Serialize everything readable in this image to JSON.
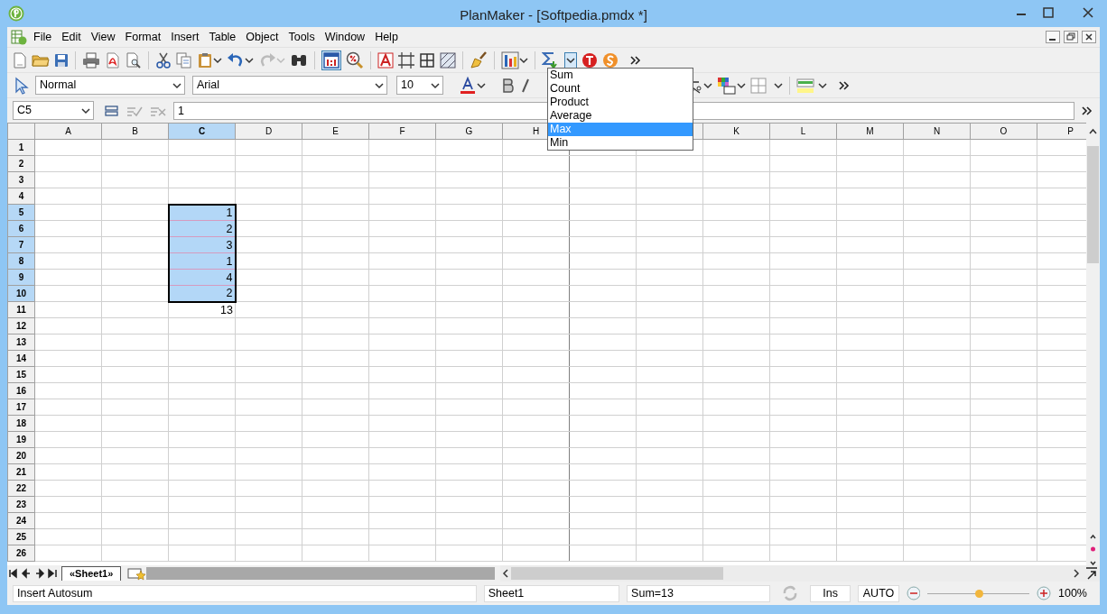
{
  "window": {
    "title": "PlanMaker - [Softpedia.pmdx *]"
  },
  "menu": [
    "File",
    "Edit",
    "View",
    "Format",
    "Insert",
    "Table",
    "Object",
    "Tools",
    "Window",
    "Help"
  ],
  "toolbar": {
    "actual_size_pressed": true,
    "redo_disabled": true,
    "autosum_expanded": true
  },
  "autosum_menu": [
    {
      "label": "Sum",
      "selected": false
    },
    {
      "label": "Count",
      "selected": false
    },
    {
      "label": "Product",
      "selected": false
    },
    {
      "label": "Average",
      "selected": false
    },
    {
      "label": "Max",
      "selected": true
    },
    {
      "label": "Min",
      "selected": false
    }
  ],
  "format_bar": {
    "style": "Normal",
    "font": "Arial",
    "size": "10"
  },
  "formula_bar": {
    "cell_reference": "C5",
    "content": "1"
  },
  "grid": {
    "columns": [
      {
        "header": "A",
        "selected": false
      },
      {
        "header": "B",
        "selected": false
      },
      {
        "header": "C",
        "selected": true
      },
      {
        "header": "D",
        "selected": false
      },
      {
        "header": "E",
        "selected": false
      },
      {
        "header": "F",
        "selected": false
      },
      {
        "header": "G",
        "selected": false
      },
      {
        "header": "H",
        "selected": false
      },
      null,
      null,
      {
        "header": "K",
        "selected": false
      },
      {
        "header": "L",
        "selected": false
      },
      {
        "header": "M",
        "selected": false
      },
      {
        "header": "N",
        "selected": false
      },
      {
        "header": "O",
        "selected": false
      },
      {
        "header": "P",
        "selected": false
      }
    ],
    "rows": [
      {
        "header": "1",
        "selected": false
      },
      {
        "header": "2",
        "selected": false
      },
      {
        "header": "3",
        "selected": false
      },
      {
        "header": "4",
        "selected": false
      },
      {
        "header": "5",
        "selected": true,
        "cells": [
          null,
          null,
          {
            "text": "1",
            "selected": true
          }
        ]
      },
      {
        "header": "6",
        "selected": true,
        "cells": [
          null,
          null,
          {
            "text": "2",
            "selected": true
          }
        ]
      },
      {
        "header": "7",
        "selected": true,
        "cells": [
          null,
          null,
          {
            "text": "3",
            "selected": true
          }
        ]
      },
      {
        "header": "8",
        "selected": true,
        "cells": [
          null,
          null,
          {
            "text": "1",
            "selected": true
          }
        ]
      },
      {
        "header": "9",
        "selected": true,
        "cells": [
          null,
          null,
          {
            "text": "4",
            "selected": true
          }
        ]
      },
      {
        "header": "10",
        "selected": true,
        "cells": [
          null,
          null,
          {
            "text": "2",
            "selected": true
          }
        ]
      },
      {
        "header": "11",
        "selected": false,
        "cells": [
          null,
          null,
          {
            "text": "13",
            "selected": false
          }
        ]
      },
      {
        "header": "12",
        "selected": false
      },
      {
        "header": "13",
        "selected": false
      },
      {
        "header": "14",
        "selected": false
      },
      {
        "header": "15",
        "selected": false
      },
      {
        "header": "16",
        "selected": false
      },
      {
        "header": "17",
        "selected": false
      },
      {
        "header": "18",
        "selected": false
      },
      {
        "header": "19",
        "selected": false
      },
      {
        "header": "20",
        "selected": false
      },
      {
        "header": "21",
        "selected": false
      },
      {
        "header": "22",
        "selected": false
      },
      {
        "header": "23",
        "selected": false
      },
      {
        "header": "24",
        "selected": false
      },
      {
        "header": "25",
        "selected": false
      },
      {
        "header": "26",
        "selected": false
      }
    ]
  },
  "sheet_tabs": [
    {
      "label": "«Sheet1»",
      "selected": true
    }
  ],
  "status_bar": {
    "message": "Insert Autosum",
    "sheet": "Sheet1",
    "sum": "Sum=13",
    "insert_mode": "Ins",
    "calc_mode": "AUTO",
    "zoom": {
      "level": 0.5
    },
    "zoom_reading": "100%"
  }
}
